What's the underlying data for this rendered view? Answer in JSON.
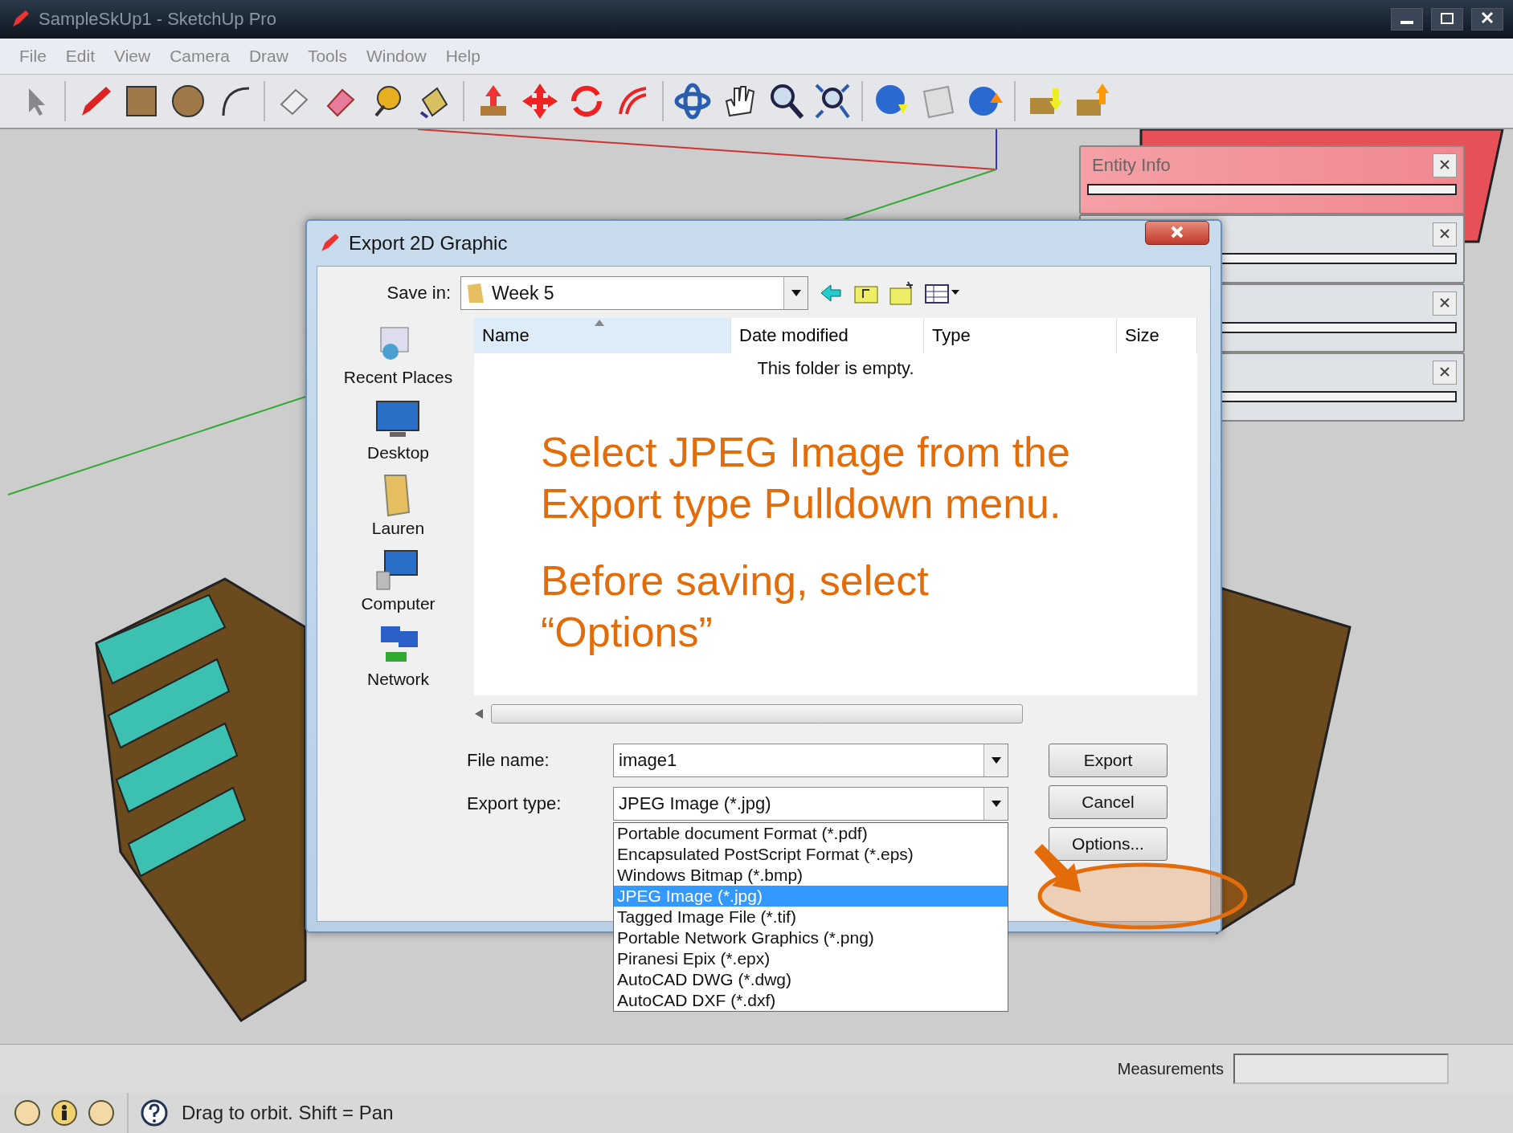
{
  "window": {
    "title": "SampleSkUp1 - SketchUp Pro"
  },
  "menu": [
    "File",
    "Edit",
    "View",
    "Camera",
    "Draw",
    "Tools",
    "Window",
    "Help"
  ],
  "trays": [
    {
      "title": "Entity Info",
      "highlighted": true
    },
    {
      "highlighted": false
    },
    {
      "highlighted": false
    },
    {
      "highlighted": false
    }
  ],
  "dialog": {
    "title": "Export 2D Graphic",
    "save_in_label": "Save in:",
    "save_in_value": "Week 5",
    "places": [
      {
        "kind": "recent",
        "label": "Recent Places"
      },
      {
        "kind": "desktop",
        "label": "Desktop"
      },
      {
        "kind": "user",
        "label": "Lauren"
      },
      {
        "kind": "computer",
        "label": "Computer"
      },
      {
        "kind": "network",
        "label": "Network"
      }
    ],
    "columns": [
      {
        "label": "Name",
        "sorted": true
      },
      {
        "label": "Date modified",
        "sorted": false
      },
      {
        "label": "Type",
        "sorted": false
      },
      {
        "label": "Size",
        "sorted": false
      }
    ],
    "empty_message": "This folder is empty.",
    "file_name_label": "File name:",
    "file_name": "image1",
    "export_type_label": "Export type:",
    "export_type": "JPEG Image (*.jpg)",
    "type_options": [
      {
        "label": "Portable document Format (*.pdf)",
        "selected": false
      },
      {
        "label": "Encapsulated PostScript Format (*.eps)",
        "selected": false
      },
      {
        "label": "Windows Bitmap (*.bmp)",
        "selected": false
      },
      {
        "label": "JPEG Image (*.jpg)",
        "selected": true
      },
      {
        "label": "Tagged Image File (*.tif)",
        "selected": false
      },
      {
        "label": "Portable Network Graphics (*.png)",
        "selected": false
      },
      {
        "label": "Piranesi Epix (*.epx)",
        "selected": false
      },
      {
        "label": "AutoCAD DWG (*.dwg)",
        "selected": false
      },
      {
        "label": "AutoCAD DXF (*.dxf)",
        "selected": false
      }
    ],
    "buttons": [
      "Export",
      "Cancel",
      "Options..."
    ]
  },
  "annotation": {
    "paragraphs": [
      [
        "Select JPEG Image from the",
        "Export type Pulldown menu."
      ],
      [
        "Before saving, select",
        "“Options”"
      ]
    ]
  },
  "measurements": {
    "label": "Measurements"
  },
  "status": {
    "hint": "Drag to orbit.  Shift = Pan"
  }
}
